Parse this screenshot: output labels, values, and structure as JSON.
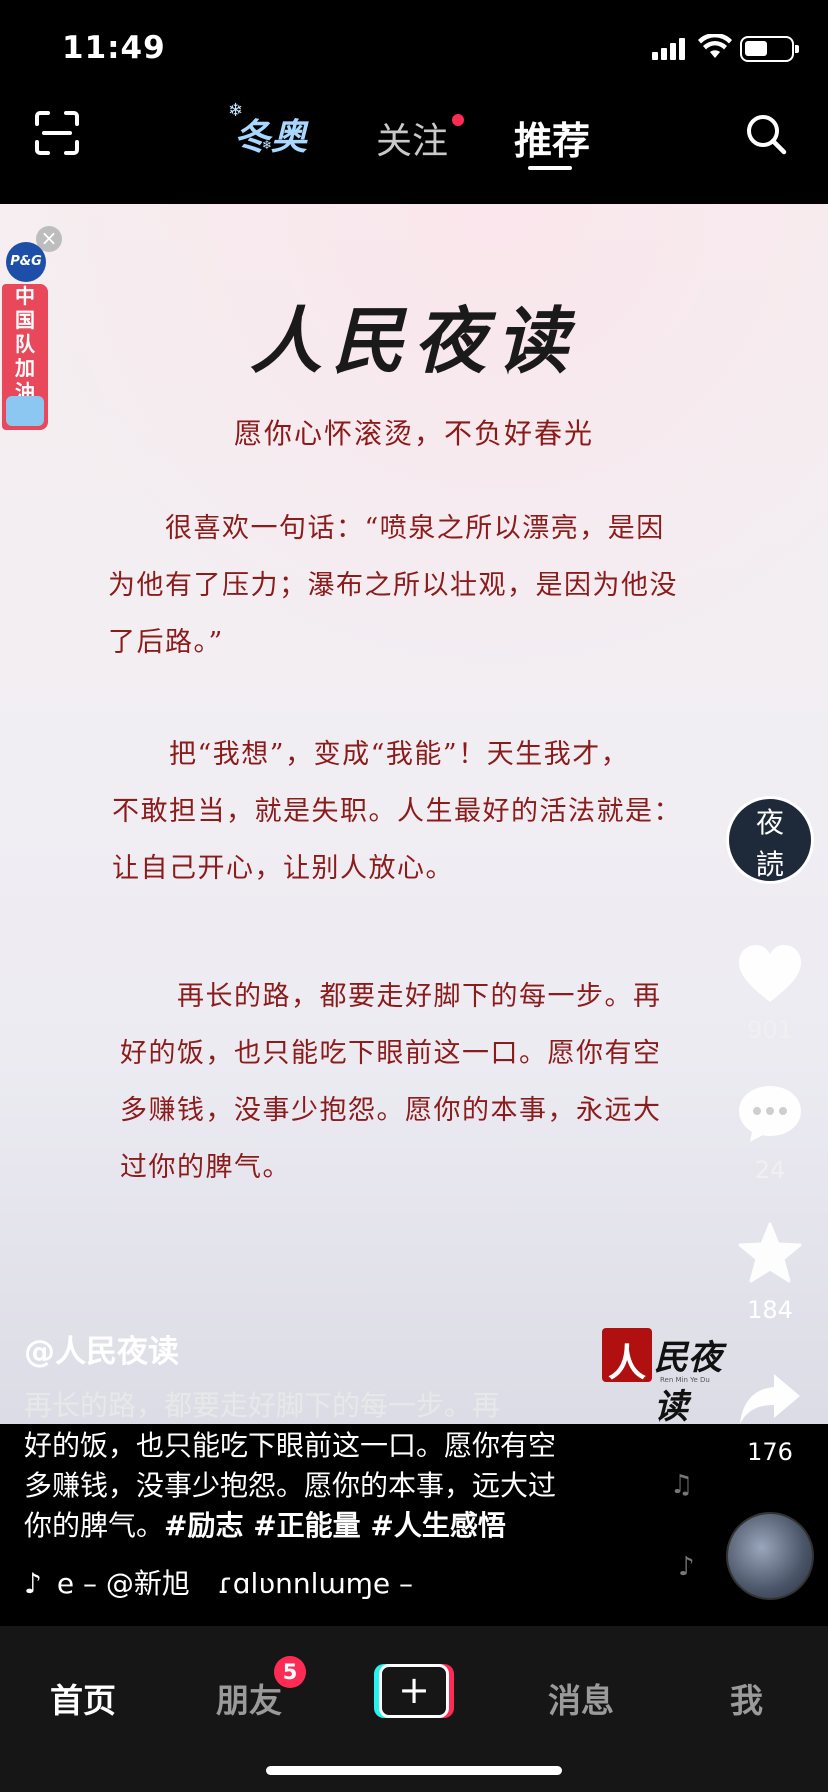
{
  "status": {
    "time": "11:49"
  },
  "topnav": {
    "winter_tab": "冬奥",
    "follow_tab": "关注",
    "recommend_tab": "推荐"
  },
  "ad": {
    "brand": "P&G",
    "lines": [
      "中",
      "国",
      "队",
      "加",
      "油"
    ],
    "close": "×"
  },
  "video": {
    "logo_title": "人民夜读",
    "subtitle": "愿你心怀滚烫，不负好春光",
    "paragraph1": [
      "　　很喜欢一句话：“喷泉之所以漂亮，是因",
      "为他有了压力；瀑布之所以壮观，是因为他没",
      "了后路。”"
    ],
    "paragraph2": [
      "　　把“我想”，变成“我能”！天生我才，",
      "不敢担当，就是失职。人生最好的活法就是：",
      "让自己开心，让别人放心。"
    ],
    "paragraph3": [
      "　　再长的路，都要走好脚下的每一步。再",
      "好的饭，也只能吃下眼前这一口。愿你有空",
      "多赚钱，没事少抱怨。愿你的本事，永远大",
      "过你的脾气。"
    ],
    "watermark": {
      "mark": "人",
      "text": "民夜读",
      "small": "Ren Min Ye Du"
    }
  },
  "rail": {
    "avatar_text": [
      "夜",
      "読"
    ],
    "likes": "901",
    "comments": "24",
    "favorites": "184",
    "shares": "176"
  },
  "caption": {
    "author": "@人民夜读",
    "line1": "再长的路，都要走好脚下的每一步。再",
    "line2": "好的饭，也只能吃下眼前这一口。愿你有空",
    "line3": "多赚钱，没事少抱怨。愿你的本事，远大过",
    "line4_text": "你的脾气。",
    "tags": "#励志 #正能量 #人生感悟",
    "music": "e – @新旭　ɾɑlʋnnlɯɱe –"
  },
  "bottomnav": {
    "home": "首页",
    "friends": "朋友",
    "friends_badge": "5",
    "plus": "+",
    "messages": "消息",
    "me": "我"
  },
  "colors": {
    "accent_red": "#fe2c55",
    "text_dark_red": "#8b1c1c",
    "nav_bg": "#161616"
  }
}
